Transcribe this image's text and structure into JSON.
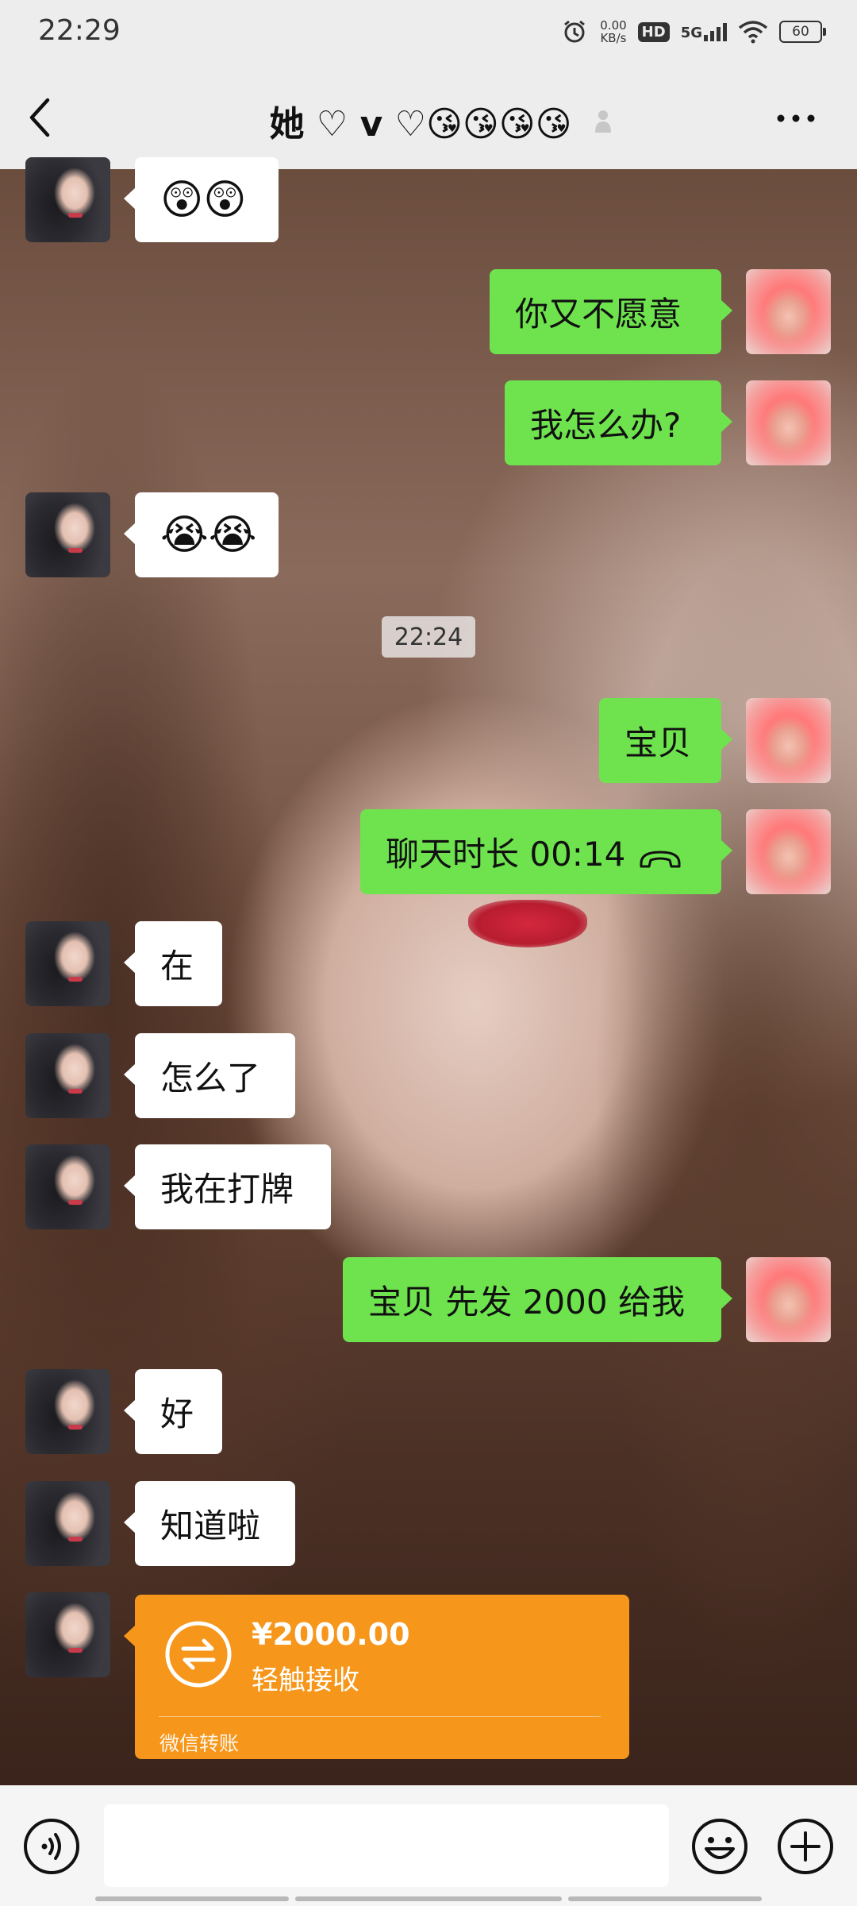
{
  "status_bar": {
    "time": "22:29",
    "net_speed_value": "0.00",
    "net_speed_unit": "KB/s",
    "hd_label": "HD",
    "network": "5G",
    "battery": "60"
  },
  "header": {
    "title": "她 ♡ v ♡😘😘😘😘"
  },
  "timestamp": "22:24",
  "messages": [
    {
      "side": "left",
      "text": "😲😲"
    },
    {
      "side": "right",
      "text": "你又不愿意"
    },
    {
      "side": "right",
      "text": "我怎么办?"
    },
    {
      "side": "left",
      "text": "😭😭"
    },
    {
      "side": "right",
      "text": "宝贝"
    },
    {
      "side": "right",
      "text": "聊天时长 00:14"
    },
    {
      "side": "left",
      "text": "在"
    },
    {
      "side": "left",
      "text": "怎么了"
    },
    {
      "side": "left",
      "text": "我在打牌"
    },
    {
      "side": "right",
      "text": "宝贝 先发 2000 给我"
    },
    {
      "side": "left",
      "text": "好"
    },
    {
      "side": "left",
      "text": "知道啦"
    }
  ],
  "transfer": {
    "amount": "¥2000.00",
    "action": "轻触接收",
    "label": "微信转账"
  },
  "colors": {
    "bar_bg": "#ededed",
    "bubble_self": "#6ee34e",
    "bubble_other": "#ffffff",
    "transfer": "#f6961a"
  }
}
